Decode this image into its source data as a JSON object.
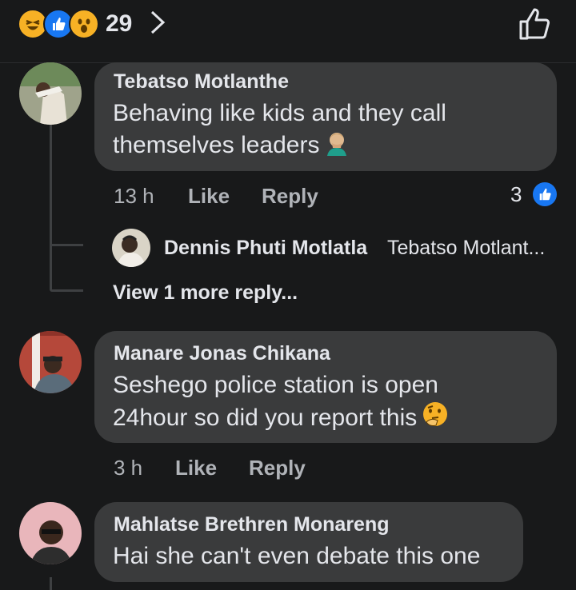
{
  "header": {
    "reaction_count": "29",
    "reaction_icons": [
      "haha-icon",
      "like-icon",
      "wow-icon"
    ]
  },
  "comments": [
    {
      "author": "Tebatso Motlanthe",
      "text_line1": "Behaving like kids and they call",
      "text_line2": "themselves leaders",
      "emoji": "facepalm-icon",
      "time": "13 h",
      "like_label": "Like",
      "reply_label": "Reply",
      "like_count": "3",
      "reply": {
        "author": "Dennis Phuti Motlatla",
        "preview": "Tebatso Motlant..."
      },
      "view_more": "View 1 more reply..."
    },
    {
      "author": "Manare Jonas Chikana",
      "text_line1": "Seshego police station is open",
      "text_line2": "24hour so did you report this",
      "emoji": "thinking-icon",
      "time": "3 h",
      "like_label": "Like",
      "reply_label": "Reply"
    },
    {
      "author": "Mahlatse Brethren Monareng",
      "text_line1": "Hai she can't even debate this one"
    }
  ],
  "colors": {
    "background": "#18191a",
    "bubble": "#3a3b3c",
    "accent": "#1877f2",
    "muted_text": "#b0b3b8"
  }
}
